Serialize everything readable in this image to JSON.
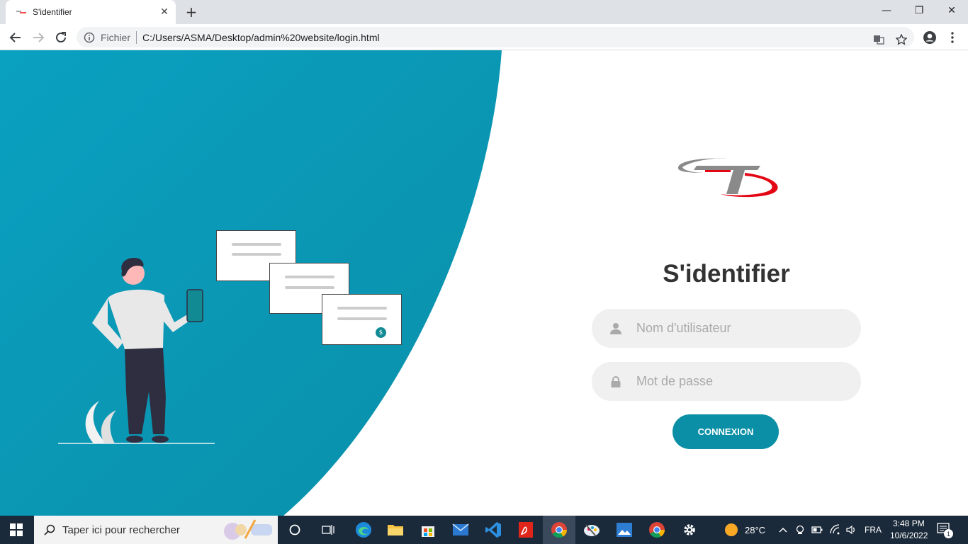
{
  "browser": {
    "tab_title": "S'identifier",
    "tab_close": "✕",
    "new_tab": "+",
    "window_controls": {
      "minimize": "—",
      "maximize": "❐",
      "close": "✕"
    },
    "address": {
      "scheme_label": "Fichier",
      "url": "C:/Users/ASMA/Desktop/admin%20website/login.html"
    }
  },
  "login": {
    "title": "S'identifier",
    "username_placeholder": "Nom d'utilisateur",
    "password_placeholder": "Mot de passe",
    "submit_label": "CONNEXION"
  },
  "illustration": {
    "card_symbol": "$"
  },
  "taskbar": {
    "search_placeholder": "Taper ici pour rechercher",
    "weather": "28°C",
    "language": "FRA",
    "time": "3:48 PM",
    "date": "10/6/2022",
    "notification_count": "1"
  },
  "colors": {
    "primary": "#0b8fa6",
    "background_panel": "#0c9bbd",
    "heading": "#333333"
  }
}
